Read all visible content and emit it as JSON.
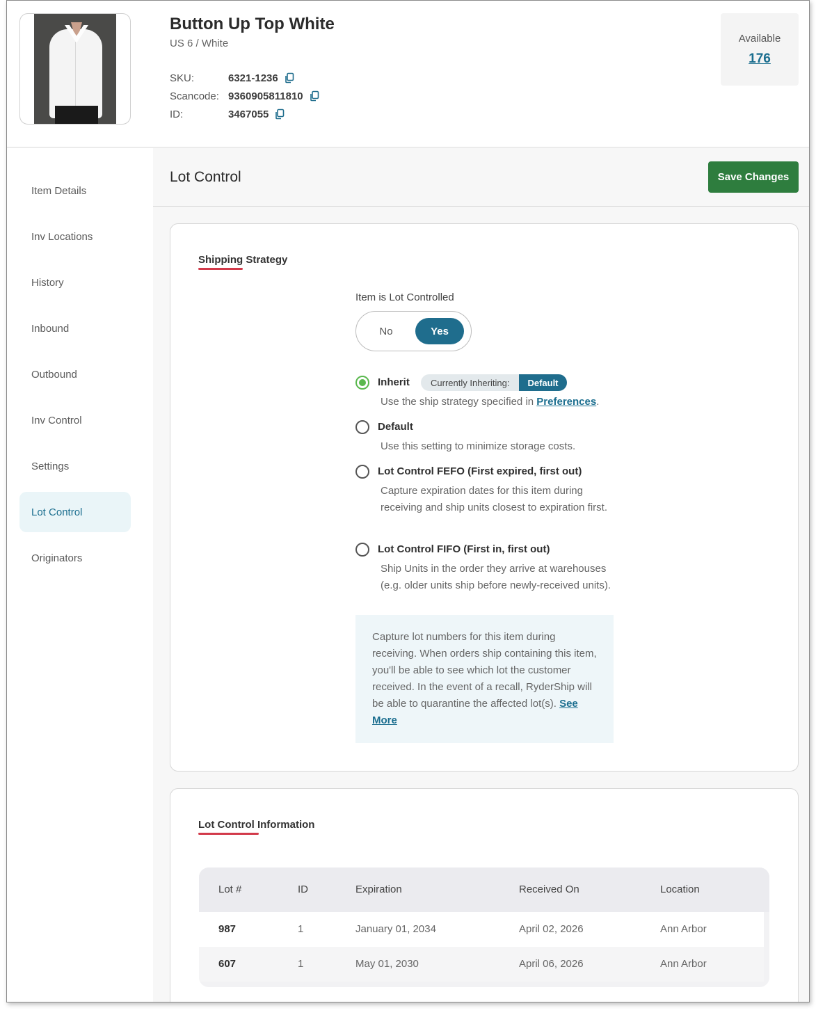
{
  "product": {
    "title": "Button Up Top White",
    "variant": "US 6 / White",
    "sku_label": "SKU:",
    "sku": "6321-1236",
    "scancode_label": "Scancode:",
    "scancode": "9360905811810",
    "id_label": "ID:",
    "id": "3467055",
    "available_label": "Available",
    "available": "176"
  },
  "sidebar": {
    "items": [
      {
        "label": "Item Details"
      },
      {
        "label": "Inv Locations"
      },
      {
        "label": "History"
      },
      {
        "label": "Inbound"
      },
      {
        "label": "Outbound"
      },
      {
        "label": "Inv Control"
      },
      {
        "label": "Settings"
      },
      {
        "label": "Lot Control",
        "active": true
      },
      {
        "label": "Originators"
      }
    ]
  },
  "main": {
    "title": "Lot Control",
    "save_label": "Save Changes"
  },
  "strategy": {
    "section_title": "Shipping Strategy",
    "lot_controlled_label": "Item is Lot Controlled",
    "toggle_no": "No",
    "toggle_yes": "Yes",
    "toggle_value": "Yes",
    "options": [
      {
        "title": "Inherit",
        "desc_prefix": "Use the ship strategy specified in ",
        "desc_link": "Preferences",
        "desc_suffix": ".",
        "selected": true
      },
      {
        "title": "Default",
        "desc": "Use this setting to minimize storage costs."
      },
      {
        "title": "Lot Control FEFO (First expired, first out)",
        "desc": "Capture expiration dates for this item during receiving and ship units closest to expiration first."
      },
      {
        "title": "Lot Control FIFO (First in, first out)",
        "desc": "Ship Units in the order they arrive at warehouses (e.g. older units ship before newly-received units)."
      }
    ],
    "inherit_pill_label": "Currently Inheriting:",
    "inherit_pill_value": "Default",
    "info_text": "Capture lot numbers for this item during receiving. When orders ship containing this item, you'll be able to see which lot the customer received. In the event of a recall, RyderShip will be able to quarantine the affected lot(s). ",
    "info_link": "See More"
  },
  "lot_info": {
    "section_title": "Lot Control Information",
    "columns": [
      "Lot #",
      "ID",
      "Expiration",
      "Received On",
      "Location"
    ],
    "rows": [
      [
        "987",
        "1",
        "January 01, 2034",
        "April 02, 2026",
        "Ann Arbor"
      ],
      [
        "607",
        "1",
        "May 01, 2030",
        "April 06, 2026",
        "Ann Arbor"
      ]
    ]
  },
  "colors": {
    "accent": "#1f6d8d",
    "save_button": "#2e7d3e",
    "section_underline": "#d23a4a",
    "radio_selected": "#5ab84e"
  }
}
